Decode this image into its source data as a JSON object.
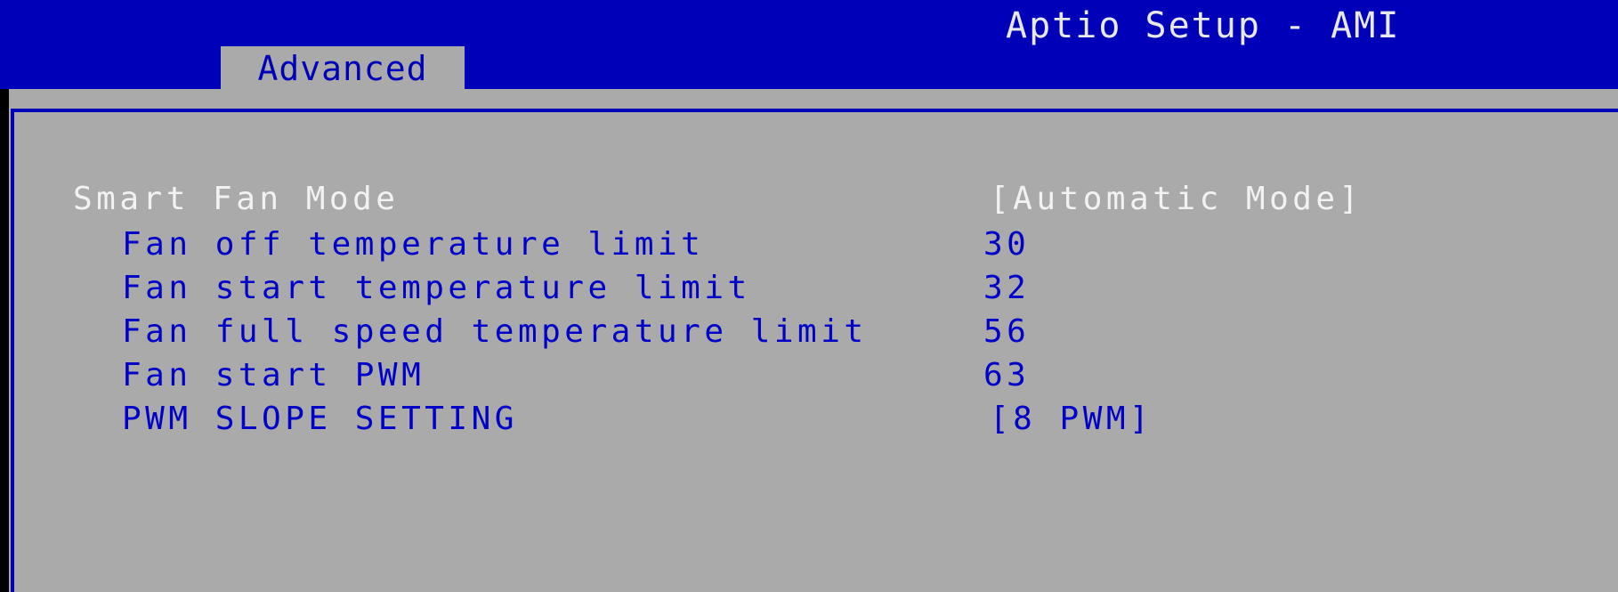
{
  "header": {
    "title": "Aptio Setup - AMI",
    "tab_label": "Advanced"
  },
  "settings": [
    {
      "label": "Smart Fan Mode",
      "value": "[Automatic Mode]"
    },
    {
      "label": "Fan off temperature limit",
      "value": "30"
    },
    {
      "label": "Fan start temperature limit",
      "value": "32"
    },
    {
      "label": "Fan full speed temperature limit",
      "value": "56"
    },
    {
      "label": "Fan start PWM",
      "value": "63"
    },
    {
      "label": "PWM SLOPE SETTING",
      "value": "[8 PWM]"
    }
  ],
  "colors": {
    "header_bg": "#0000b8",
    "panel_bg": "#aaaaaa",
    "text_blue": "#0000c8",
    "text_white": "#f2f2f2"
  }
}
